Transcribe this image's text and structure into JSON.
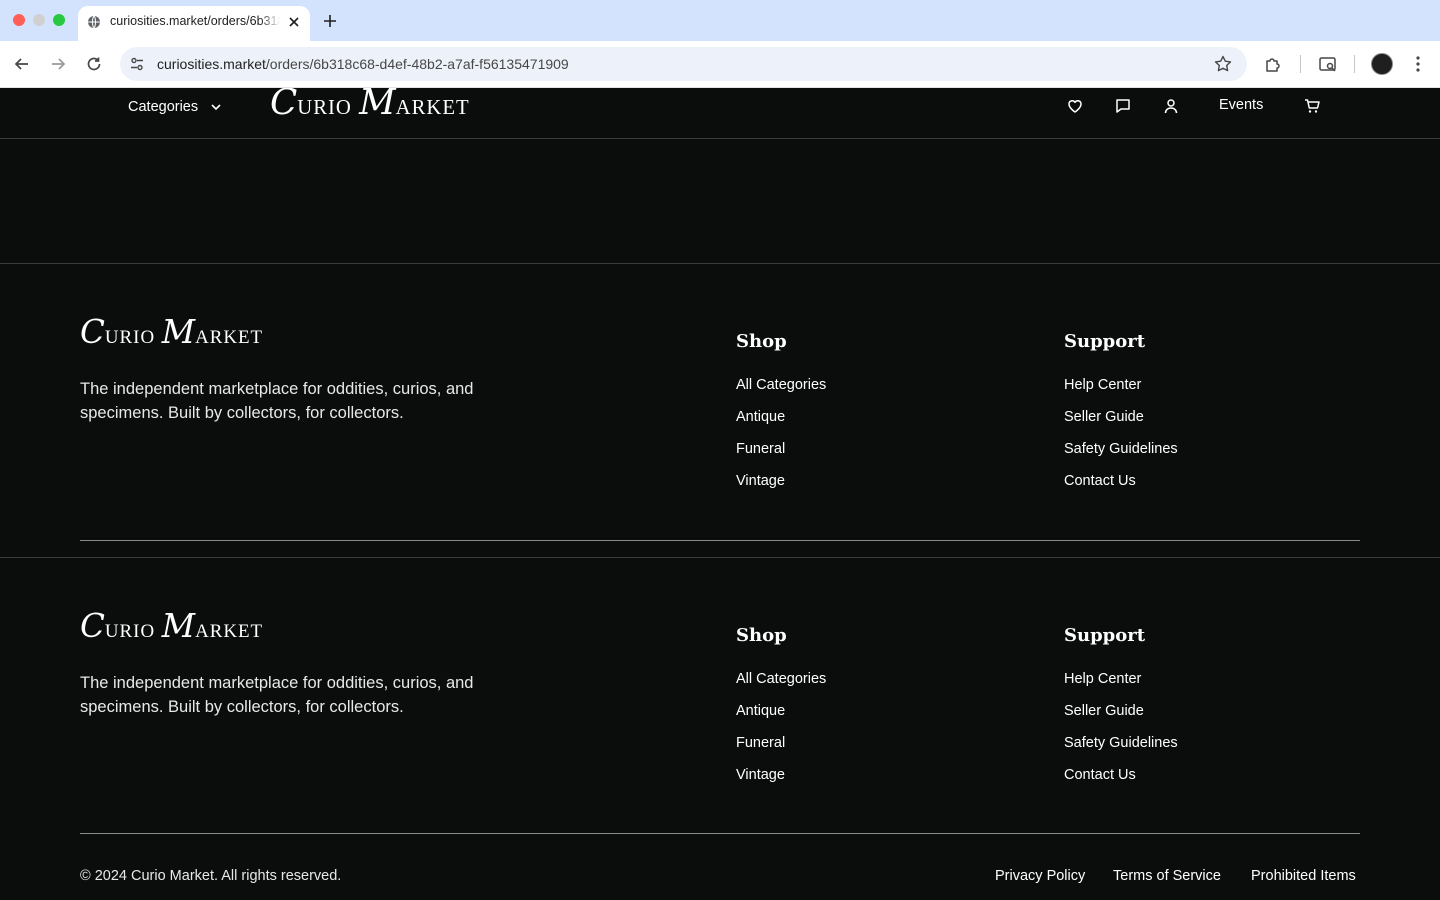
{
  "browser": {
    "tab_title": "curiosities.market/orders/6b318c68-d4ef-48b2-a7af-f56135471909",
    "url_host": "curiosities.market",
    "url_path": "/orders/6b318c68-d4ef-48b2-a7af-f56135471909"
  },
  "header": {
    "categories_label": "Categories",
    "logo_c": "C",
    "logo_urio": "URIO",
    "logo_m": "M",
    "logo_arket": "ARKET",
    "events_label": "Events"
  },
  "footer": {
    "logo_c": "C",
    "logo_urio": "URIO",
    "logo_m": "M",
    "logo_arket": "ARKET",
    "tagline": "The independent marketplace for oddities, curios, and specimens. Built by collectors, for collectors.",
    "shop_title": "Shop",
    "shop_links": [
      "All Categories",
      "Antique",
      "Funeral",
      "Vintage"
    ],
    "support_title": "Support",
    "support_links": [
      "Help Center",
      "Seller Guide",
      "Safety Guidelines",
      "Contact Us"
    ],
    "copyright": "© 2024 Curio Market. All rights reserved.",
    "legal_links": [
      "Privacy Policy",
      "Terms of Service",
      "Prohibited Items"
    ]
  }
}
